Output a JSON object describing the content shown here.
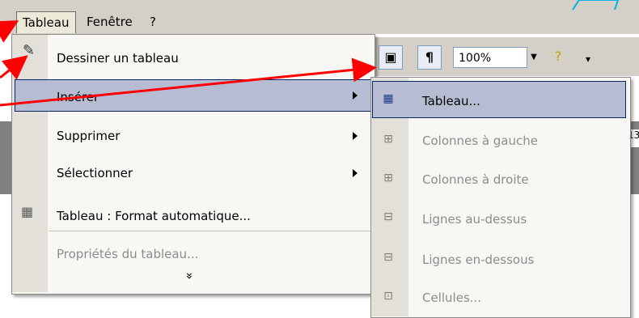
{
  "menubar": {
    "items": [
      {
        "label": "Tableau",
        "active": true
      },
      {
        "label": "Fenêtre",
        "active": false
      },
      {
        "label": "?",
        "active": false
      }
    ]
  },
  "toolbar": {
    "zoom": "100%",
    "pilcrow": "¶"
  },
  "ruler_number": "13",
  "menu": {
    "items": [
      {
        "label": "Dessiner un tableau",
        "disabled": false,
        "submenu": false
      },
      {
        "label": "Insérer",
        "disabled": false,
        "submenu": true,
        "selected": true
      },
      {
        "label": "Supprimer",
        "disabled": false,
        "submenu": true
      },
      {
        "label": "Sélectionner",
        "disabled": false,
        "submenu": true
      },
      {
        "label": "Tableau : Format automatique...",
        "disabled": false,
        "submenu": false
      },
      {
        "label": "Propriétés du tableau...",
        "disabled": true,
        "submenu": false
      }
    ],
    "expand": "»"
  },
  "submenu": {
    "items": [
      {
        "label": "Tableau...",
        "disabled": false,
        "selected": true
      },
      {
        "label": "Colonnes à gauche",
        "disabled": true
      },
      {
        "label": "Colonnes à droite",
        "disabled": true
      },
      {
        "label": "Lignes au-dessus",
        "disabled": true
      },
      {
        "label": "Lignes en-dessous",
        "disabled": true
      },
      {
        "label": "Cellules...",
        "disabled": true
      }
    ]
  },
  "colors": {
    "annotation_arrow": "#ff0000",
    "selection": "#b6bdd2",
    "menu_bg": "#f8f7f3"
  }
}
